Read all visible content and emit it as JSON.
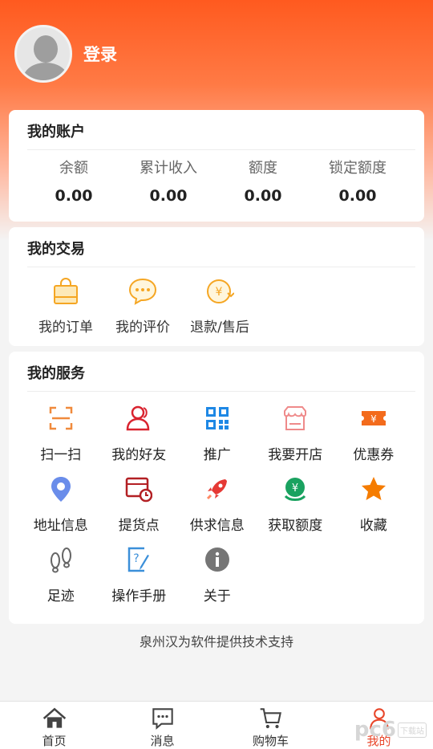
{
  "header": {
    "login_label": "登录"
  },
  "account": {
    "title": "我的账户",
    "stats": [
      {
        "label": "余额",
        "value": "0.00"
      },
      {
        "label": "累计收入",
        "value": "0.00"
      },
      {
        "label": "额度",
        "value": "0.00"
      },
      {
        "label": "锁定额度",
        "value": "0.00"
      }
    ]
  },
  "trade": {
    "title": "我的交易",
    "items": [
      {
        "label": "我的订单",
        "icon": "shopping-bag-icon"
      },
      {
        "label": "我的评价",
        "icon": "chat-bubble-icon"
      },
      {
        "label": "退款/售后",
        "icon": "refund-icon"
      }
    ]
  },
  "service": {
    "title": "我的服务",
    "items": [
      {
        "label": "扫一扫",
        "icon": "scan-icon"
      },
      {
        "label": "我的好友",
        "icon": "friends-icon"
      },
      {
        "label": "推广",
        "icon": "qr-code-icon"
      },
      {
        "label": "我要开店",
        "icon": "store-icon"
      },
      {
        "label": "优惠券",
        "icon": "coupon-icon"
      },
      {
        "label": "地址信息",
        "icon": "location-pin-icon"
      },
      {
        "label": "提货点",
        "icon": "pickup-point-icon"
      },
      {
        "label": "供求信息",
        "icon": "rocket-icon"
      },
      {
        "label": "获取额度",
        "icon": "get-credit-icon"
      },
      {
        "label": "收藏",
        "icon": "star-icon"
      },
      {
        "label": "足迹",
        "icon": "footprint-icon"
      },
      {
        "label": "操作手册",
        "icon": "manual-icon"
      },
      {
        "label": "关于",
        "icon": "info-icon"
      }
    ]
  },
  "footer": {
    "support_text": "泉州汉为软件提供技术支持"
  },
  "tabbar": {
    "tabs": [
      {
        "label": "首页",
        "icon": "home-icon"
      },
      {
        "label": "消息",
        "icon": "message-icon"
      },
      {
        "label": "购物车",
        "icon": "cart-icon"
      },
      {
        "label": "我的",
        "icon": "profile-icon"
      }
    ]
  },
  "watermark": {
    "text": "pc6",
    "badge": "下载站"
  },
  "colors": {
    "primary": "#ff5a1f",
    "accent_red": "#e8462a",
    "icon_orange": "#f5a623",
    "icon_blue": "#1e88e5"
  }
}
